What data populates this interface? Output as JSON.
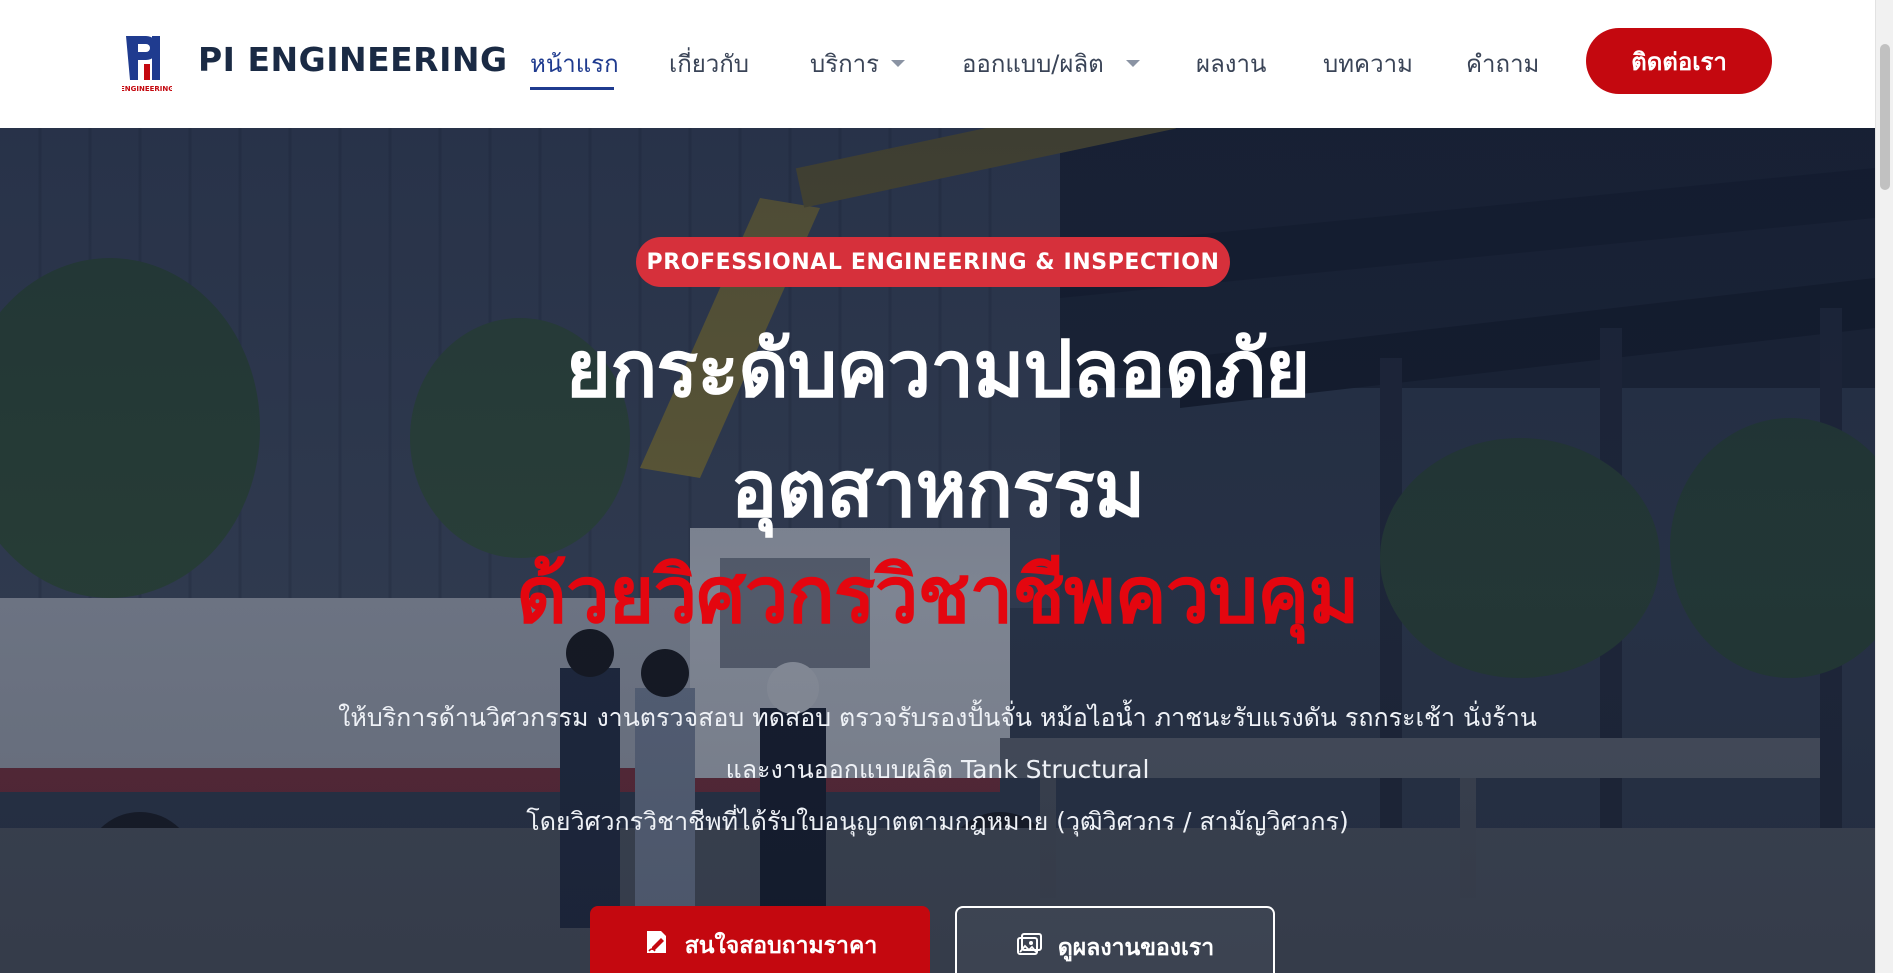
{
  "header": {
    "brand": "PI ENGINEERING",
    "logo_text": "ENGINEERING",
    "nav": [
      {
        "label": "หน้าแรก",
        "active": true
      },
      {
        "label": "เกี่ยวกับ"
      },
      {
        "label": "บริการ",
        "has_dropdown": true
      },
      {
        "label": "ออกแบบ/ผลิต",
        "has_dropdown": true
      },
      {
        "label": "ผลงาน"
      },
      {
        "label": "บทความ"
      },
      {
        "label": "คำถาม"
      }
    ],
    "contact_label": "ติดต่อเรา"
  },
  "hero": {
    "badge": "PROFESSIONAL ENGINEERING & INSPECTION",
    "headline_line1": "ยกระดับความปลอดภัย",
    "headline_line2": "อุตสาหกรรม",
    "headline_line3": "ด้วยวิศวกรวิชาชีพควบคุม",
    "description_line1": "ให้บริการด้านวิศวกรรม งานตรวจสอบ ทดสอบ ตรวจรับรองปั้นจั่น หม้อไอน้ำ ภาชนะรับแรงดัน รถกระเช้า นั่งร้าน",
    "description_line2": "และงานออกแบบผลิต Tank Structural",
    "description_line3": "โดยวิศวกรวิชาชีพที่ได้รับใบอนุญาตตามกฎหมาย (วุฒิวิศวกร / สามัญวิศวกร)",
    "primary_button": "สนใจสอบถามราคา",
    "secondary_button": "ดูผลงานของเรา"
  },
  "colors": {
    "brand_navy": "#1f3b8f",
    "accent_red": "#c4080f",
    "badge_red": "#d6303b",
    "headline_red": "#e4060f"
  },
  "icons": {
    "primary_button_icon": "edit-document-icon",
    "secondary_button_icon": "image-gallery-icon",
    "dropdown_icon": "caret-down-icon"
  }
}
